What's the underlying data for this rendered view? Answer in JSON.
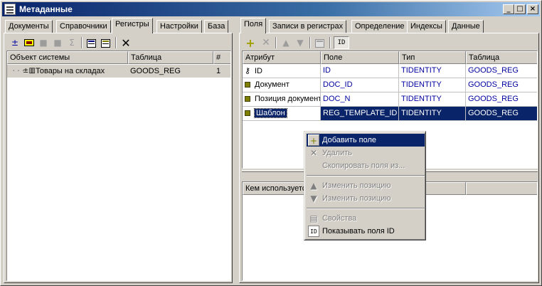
{
  "window": {
    "title": "Метаданные",
    "controls": {
      "minimize": "_",
      "maximize": "□",
      "close": "×"
    }
  },
  "left": {
    "tabs": [
      "Документы",
      "Справочники",
      "Регистры",
      "Настройки",
      "База"
    ],
    "active_tab": "Регистры",
    "toolbar_icons": [
      "add-register-icon",
      "edit-icon",
      "stop-icon",
      "stop-icon",
      "sum-icon",
      "properties-icon",
      "properties-alt-icon",
      "delete-icon"
    ],
    "table": {
      "headers": [
        "Объект системы",
        "Таблица",
        "#"
      ],
      "rows": [
        {
          "object": "Товары на складах",
          "table": "GOODS_REG",
          "num": "1"
        }
      ]
    }
  },
  "right": {
    "tabs": [
      "Поля",
      "Записи в регистрах",
      "Определение",
      "Индексы",
      "Данные"
    ],
    "active_tab": "Поля",
    "toolbar": {
      "id_button": "ID"
    },
    "fields_table": {
      "headers": [
        "Атрибут",
        "Поле",
        "Тип",
        "Таблица"
      ],
      "rows": [
        {
          "attr": "ID",
          "field": "ID",
          "type": "TIDENTITY",
          "table": "GOODS_REG",
          "icon": "key-icon"
        },
        {
          "attr": "Документ",
          "field": "DOC_ID",
          "type": "TIDENTITY",
          "table": "GOODS_REG",
          "icon": "field-icon"
        },
        {
          "attr": "Позиция документа",
          "field": "DOC_N",
          "type": "TIDENTITY",
          "table": "GOODS_REG",
          "icon": "field-icon"
        },
        {
          "attr": "Шаблон",
          "field": "REG_TEMPLATE_ID",
          "type": "TIDENTITY",
          "table": "GOODS_REG",
          "icon": "field-icon",
          "selected": true
        }
      ]
    },
    "usage_table": {
      "headers": [
        "Кем используется",
        "",
        "",
        ""
      ]
    }
  },
  "context_menu": {
    "items": [
      {
        "label": "Добавить поле",
        "icon": "plus-icon",
        "disabled": false,
        "highlighted": true
      },
      {
        "label": "Удалить",
        "icon": "delete-icon",
        "disabled": true
      },
      {
        "label": "Скопировать поля из...",
        "icon": "",
        "disabled": true
      },
      {
        "label": "Изменить позицию",
        "icon": "arrow-up-icon",
        "disabled": true
      },
      {
        "label": "Изменить позицию",
        "icon": "arrow-down-icon",
        "disabled": true
      },
      {
        "label": "Свойства",
        "icon": "properties-icon",
        "disabled": true
      },
      {
        "label": "Показывать поля ID",
        "icon": "id-icon",
        "disabled": false
      }
    ]
  }
}
